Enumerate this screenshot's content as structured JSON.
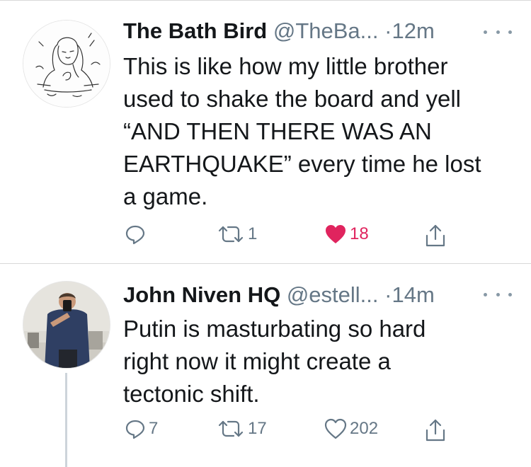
{
  "tweets": [
    {
      "name": "The Bath Bird",
      "handle": "@TheBa...",
      "time": "·12m",
      "lines": [
        "This is like how my little brother",
        "used to shake the board and yell",
        "“AND THEN THERE WAS AN",
        "EARTHQUAKE” every time he lost",
        "a game."
      ],
      "replies": "",
      "retweets": "1",
      "likes": "18",
      "liked": true
    },
    {
      "name": "John Niven HQ",
      "handle": "@estell...",
      "time": "·14m",
      "lines": [
        "Putin is masturbating so hard",
        "right now it might create a",
        "tectonic shift."
      ],
      "replies": "7",
      "retweets": "17",
      "likes": "202",
      "liked": false
    }
  ],
  "icons": {
    "reply": "reply-icon",
    "retweet": "retweet-icon",
    "like": "heart-icon",
    "share": "share-icon",
    "more": "more-icon"
  },
  "colors": {
    "like_active": "#e0245e",
    "secondary_text": "#657786",
    "icon": "#657786"
  }
}
